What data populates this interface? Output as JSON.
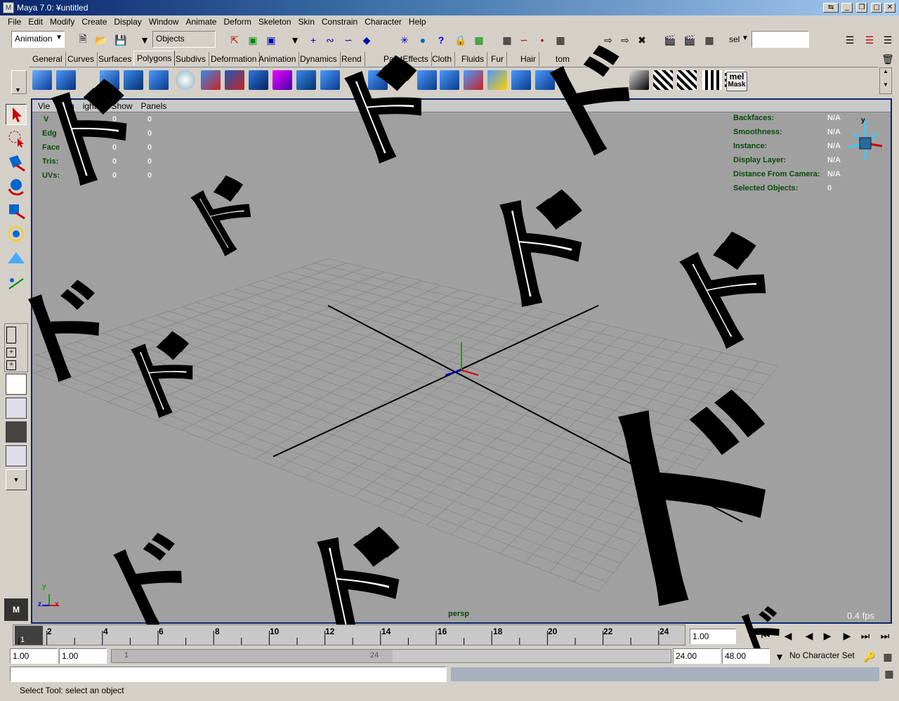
{
  "window": {
    "title": "Maya 7.0: ¥untitled",
    "buttons": [
      "⇆",
      "▁",
      "❐",
      "✕"
    ]
  },
  "menus": [
    "File",
    "Edit",
    "Modify",
    "Create",
    "Display",
    "Window",
    "Animate",
    "Deform",
    "Skeleton",
    "Skin",
    "Constrain",
    "Character",
    "Help"
  ],
  "status_line": {
    "menuset": "Animation",
    "selection_mode": "Objects",
    "sel_label": "sel",
    "sel_input": ""
  },
  "shelf_tabs": [
    "General",
    "Curves",
    "Surfaces",
    "Polygons",
    "Subdivs",
    "Deformation",
    "Animation",
    "Dynamics",
    "Rendering",
    "PaintEffects",
    "Cloth",
    "Fluids",
    "Fur",
    "Hair",
    "Custom"
  ],
  "shelf_tabs_visible": [
    "General",
    "Curves",
    "Surfaces",
    "Polygons",
    "Subdivs",
    "Deformation",
    "Animation",
    "Dynamics",
    "Rend",
    "PaintEffects",
    "Cloth",
    "Fluids",
    "Fur",
    "Hair",
    "tom"
  ],
  "active_shelf_tab": "Polygons",
  "shelf_mel_label": "mel",
  "shelf_mask_label": "Mask",
  "viewport": {
    "menu": [
      "View",
      "Shading",
      "Lighting",
      "Show",
      "Panels"
    ],
    "menu_visible": [
      "Vie",
      "adin",
      "ightin",
      "Show",
      "Panels"
    ],
    "camera": "persp",
    "fps": "0.4 fps",
    "poly_count_labels": [
      "Verts:",
      "Edges:",
      "Faces:",
      "Tris:",
      "UVs:"
    ],
    "poly_count_visible": [
      "V",
      "Edg",
      "Face",
      "Tris:",
      "UVs:"
    ],
    "poly_count_values": [
      [
        "0",
        "0",
        "0"
      ],
      [
        "0",
        "0",
        "0"
      ],
      [
        "0",
        "0",
        "0"
      ],
      [
        "0",
        "0",
        "0"
      ],
      [
        "0",
        "0",
        "0"
      ]
    ],
    "object_details": [
      {
        "label": "Backfaces:",
        "value": "N/A"
      },
      {
        "label": "Smoothness:",
        "value": "N/A"
      },
      {
        "label": "Instance:",
        "value": "N/A"
      },
      {
        "label": "Display Layer:",
        "value": "N/A"
      },
      {
        "label": "Distance From Camera:",
        "value": "N/A"
      },
      {
        "label": "Selected Objects:",
        "value": "0"
      }
    ],
    "axis_labels": {
      "x": "x",
      "y": "y",
      "z": "z"
    },
    "overlay_text": "ド"
  },
  "timeslider": {
    "current_frame": "1",
    "ticks": [
      "2",
      "4",
      "6",
      "8",
      "10",
      "12",
      "14",
      "16",
      "18",
      "20",
      "22",
      "24"
    ],
    "current_time": "1.00"
  },
  "range_slider": {
    "start_time": "1.00",
    "playback_start": "1.00",
    "range_start_label": "1",
    "range_end_label": "24",
    "playback_end": "24.00",
    "end_time": "48.00",
    "character_set": "No Character Set"
  },
  "command_line": {
    "value": ""
  },
  "help_line": "Select Tool: select an object"
}
